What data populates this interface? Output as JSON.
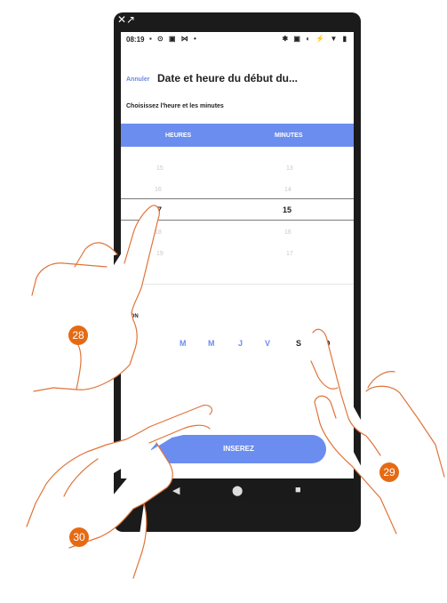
{
  "status": {
    "time": "08:19",
    "left_icons": "▪ ⊙ ▣ ⋈ •",
    "right_icons": "✱ ▣ ◐ ⚡ ▼ ▮"
  },
  "top_icons": "✕↗",
  "header": {
    "cancel": "Annuler",
    "title": "Date et heure du début du..."
  },
  "subtitle": "Choisissez l'heure et les minutes",
  "columns": {
    "hours": "HEURES",
    "minutes": "MINUTES"
  },
  "picker": {
    "hours": [
      "15",
      "16",
      "17",
      "18",
      "19"
    ],
    "minutes": [
      "13",
      "14",
      "15",
      "16",
      "17"
    ],
    "hours_selected": "17",
    "minutes_selected": "15"
  },
  "repetition_label": "TITION",
  "days": [
    "M",
    "M",
    "J",
    "V",
    "S",
    "D"
  ],
  "cta": "INSEREZ",
  "nav": {
    "back": "◀",
    "home": "⬤",
    "recents": "■"
  },
  "badges": [
    "28",
    "29",
    "30"
  ],
  "colors": {
    "accent": "#6b8df0",
    "badge": "#e66a14"
  }
}
